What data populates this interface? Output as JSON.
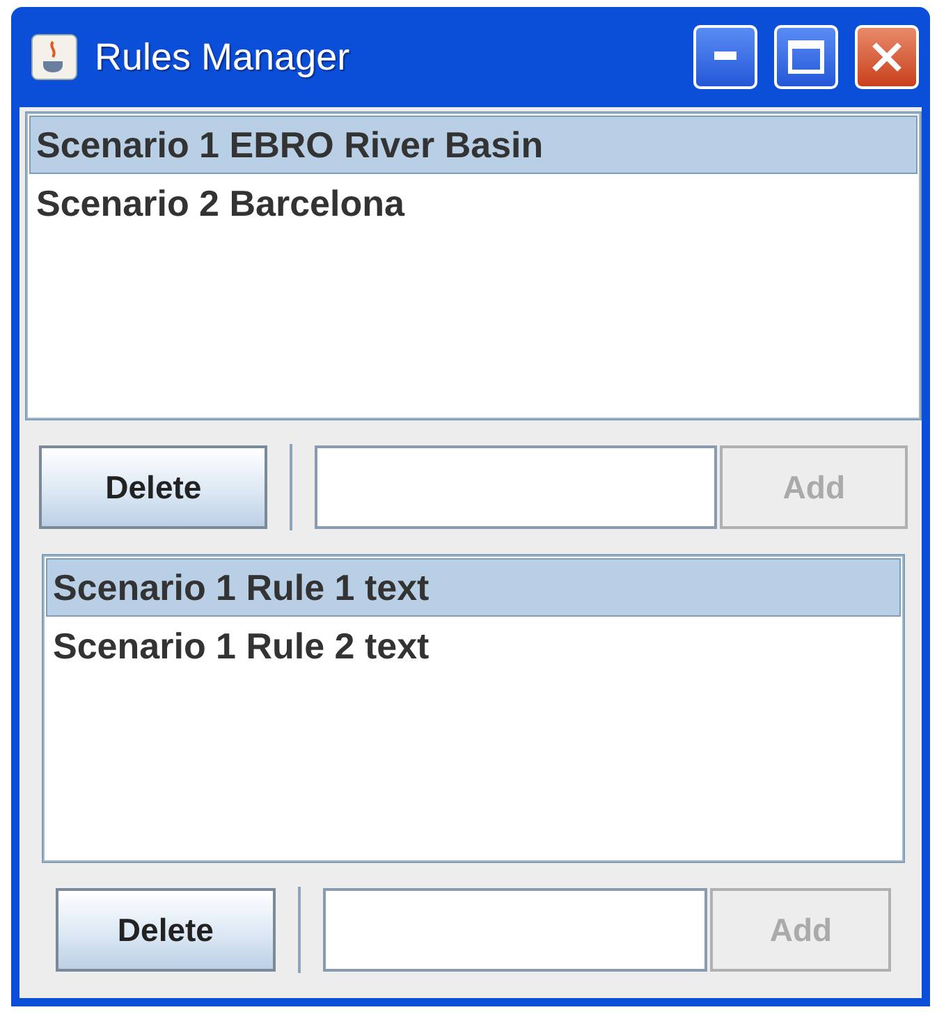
{
  "window": {
    "title": "Rules Manager"
  },
  "panel": {
    "items": [
      {
        "label": "Scenario 1 EBRO River Basin",
        "selected": true
      },
      {
        "label": "Scenario 2 Barcelona",
        "selected": false
      }
    ],
    "delete_button": {
      "label": "Delete",
      "disabled": false
    },
    "add_button": {
      "label": "Add",
      "disabled": true
    },
    "child": {
      "items": [
        {
          "label": "Scenario 1 Rule 1 text",
          "selected": true
        },
        {
          "label": "Scenario 1 Rule 2 text",
          "selected": false
        }
      ],
      "delete_button": {
        "label": "Delete",
        "disabled": false
      },
      "add_button": {
        "label": "Add",
        "disabled": true
      }
    }
  }
}
